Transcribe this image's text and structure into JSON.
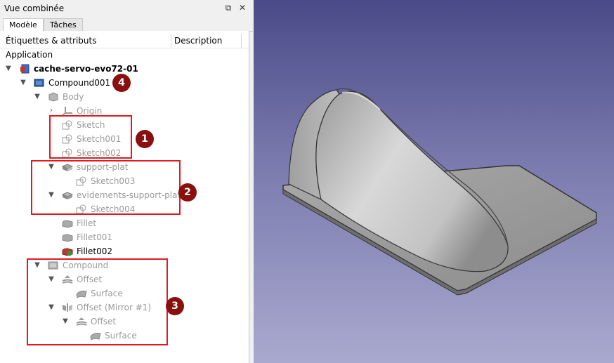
{
  "window": {
    "title": "Vue combinée"
  },
  "tabs": [
    {
      "label": "Modèle",
      "active": true
    },
    {
      "label": "Tâches",
      "active": false
    }
  ],
  "columns": {
    "labels": "Étiquettes & attributs",
    "description": "Description"
  },
  "section": "Application",
  "tree": [
    {
      "label": "cache-servo-evo72-01",
      "icon": "document-icon"
    },
    {
      "label": "Compound001",
      "icon": "compound-icon"
    },
    {
      "label": "Body",
      "icon": "body-icon"
    },
    {
      "label": "Origin",
      "icon": "origin-icon"
    },
    {
      "label": "Sketch",
      "icon": "sketch-icon"
    },
    {
      "label": "Sketch001",
      "icon": "sketch-icon"
    },
    {
      "label": "Sketch002",
      "icon": "sketch-icon"
    },
    {
      "label": "support-plat",
      "icon": "pad-icon"
    },
    {
      "label": "Sketch003",
      "icon": "sketch-icon"
    },
    {
      "label": "evidements-support-plat",
      "icon": "pocket-icon"
    },
    {
      "label": "Sketch004",
      "icon": "sketch-icon"
    },
    {
      "label": "Fillet",
      "icon": "fillet-icon"
    },
    {
      "label": "Fillet001",
      "icon": "fillet-icon"
    },
    {
      "label": "Fillet002",
      "icon": "fillet-tip-icon"
    },
    {
      "label": "Compound",
      "icon": "compound-icon"
    },
    {
      "label": "Offset",
      "icon": "offset-icon"
    },
    {
      "label": "Surface",
      "icon": "surface-icon"
    },
    {
      "label": "Offset (Mirror #1)",
      "icon": "mirror-icon"
    },
    {
      "label": "Offset",
      "icon": "offset-icon"
    },
    {
      "label": "Surface",
      "icon": "surface-icon"
    }
  ],
  "badges": [
    "1",
    "2",
    "3",
    "4"
  ],
  "colors": {
    "highlight": "#e5191d",
    "badge": "#8a1010",
    "viewport_top": "#4a4a88",
    "viewport_bottom": "#a9a9cf"
  }
}
